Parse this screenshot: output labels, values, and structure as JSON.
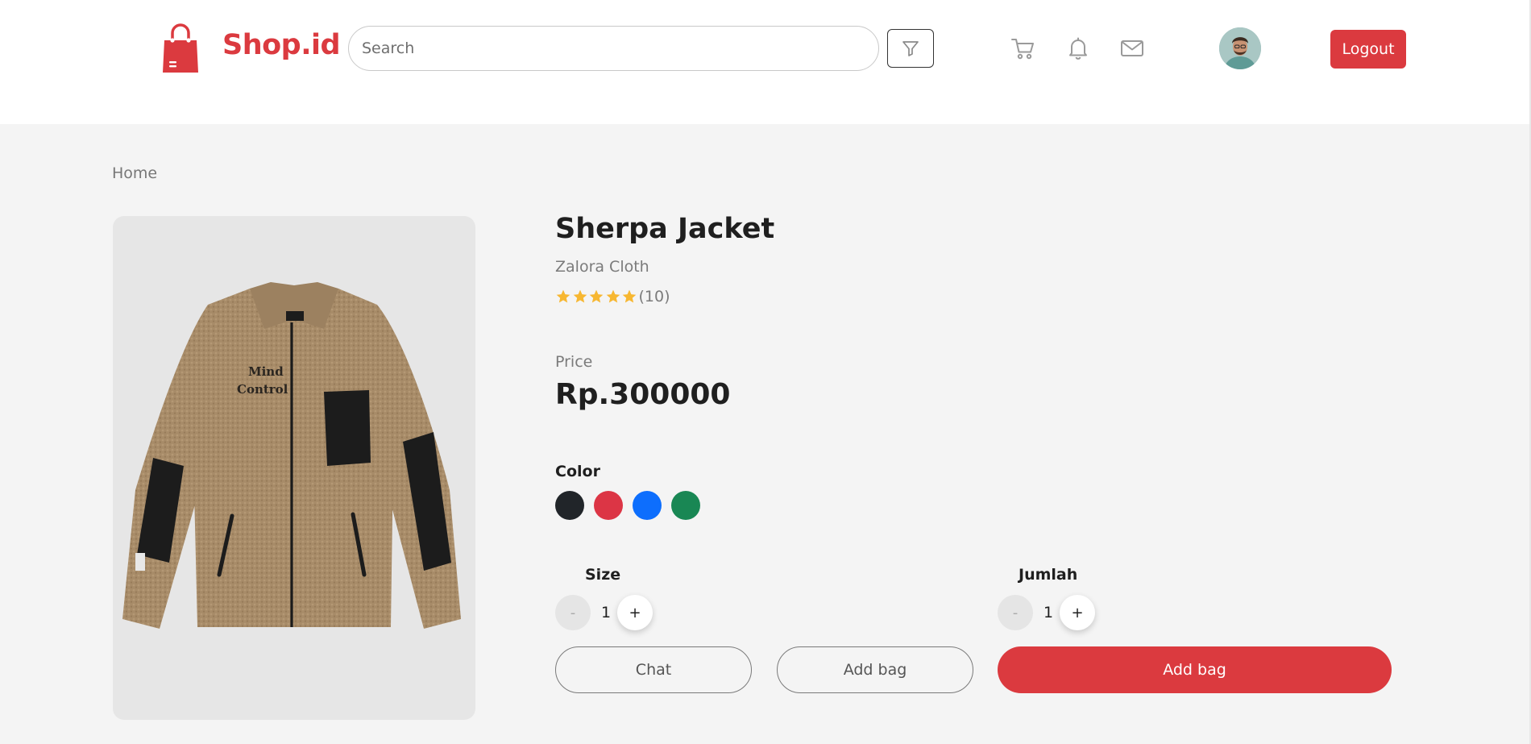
{
  "header": {
    "brand": "Shop.id",
    "search_placeholder": "Search",
    "logout_label": "Logout"
  },
  "breadcrumb": {
    "home": "Home"
  },
  "product": {
    "title": "Sherpa Jacket",
    "brand": "Zalora Cloth",
    "rating": {
      "stars": 5,
      "count_label": "(10)"
    },
    "price_label": "Price",
    "price": "Rp.300000",
    "color_label": "Color",
    "colors": [
      "#212529",
      "#dc3545",
      "#0d6efd",
      "#198754"
    ],
    "jacket_text": [
      "Mind",
      "Control"
    ]
  },
  "options": {
    "size_label": "Size",
    "size_value": "1",
    "qty_label": "Jumlah",
    "qty_value": "1",
    "minus": "-",
    "plus": "+"
  },
  "actions": {
    "chat": "Chat",
    "add_bag_outline": "Add bag",
    "add_bag_primary": "Add bag"
  },
  "theme": {
    "accent": "#db3a3f",
    "star": "#f7b731"
  }
}
